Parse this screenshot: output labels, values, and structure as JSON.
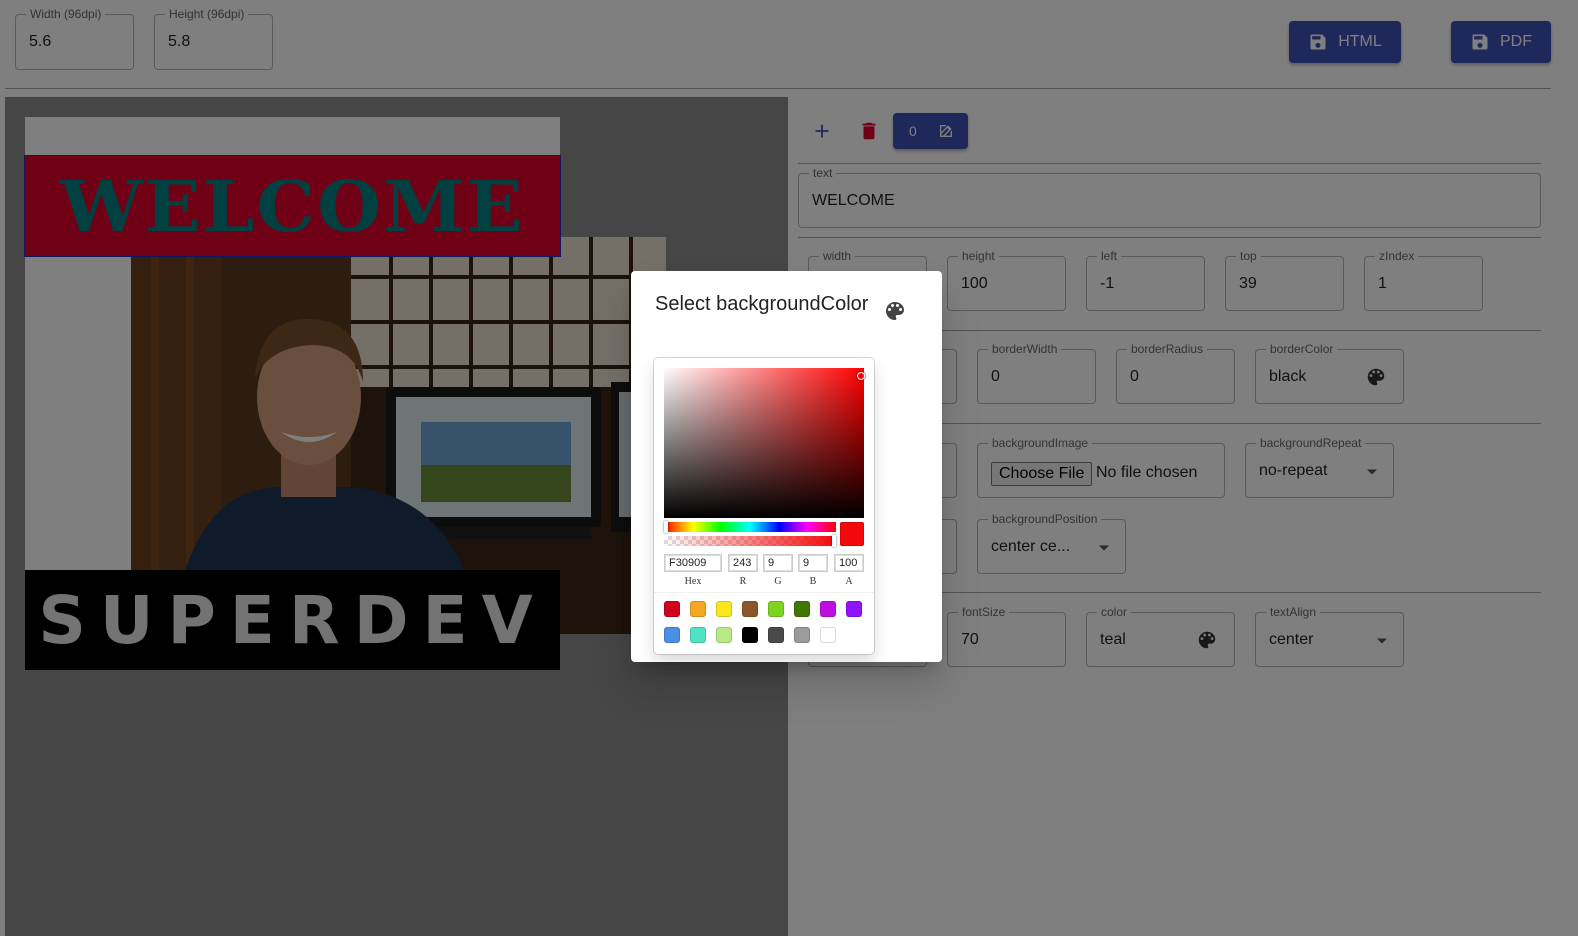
{
  "top_bar": {
    "width_label": "Width (96dpi)",
    "width_value": "5.6",
    "height_label": "Height (96dpi)",
    "height_value": "5.8",
    "html_button": "HTML",
    "pdf_button": "PDF"
  },
  "canvas": {
    "welcome_text": "WELCOME",
    "superdev_text": "SUPERDEV",
    "welcome_bg": "#e0002a",
    "welcome_color": "teal"
  },
  "toolbar": {
    "layer_index": "0"
  },
  "props": {
    "text_label": "text",
    "text_value": "WELCOME",
    "width_label": "width",
    "height_label": "height",
    "height_value": "100",
    "left_label": "left",
    "left_value": "-1",
    "top_label": "top",
    "top_value": "39",
    "zindex_label": "zIndex",
    "zindex_value": "1",
    "borderwidth_label": "borderWidth",
    "borderwidth_value": "0",
    "borderradius_label": "borderRadius",
    "borderradius_value": "0",
    "bordercolor_label": "borderColor",
    "bordercolor_value": "black",
    "bgimage_label": "backgroundImage",
    "choose_file": "Choose File",
    "no_file": "No file chosen",
    "bgrepeat_label": "backgroundRepeat",
    "bgrepeat_value": "no-repeat",
    "bgposition_label": "backgroundPosition",
    "bgposition_value": "center ce...",
    "fontsize_label": "fontSize",
    "fontsize_value": "70",
    "color_label": "color",
    "color_value": "teal",
    "textalign_label": "textAlign",
    "textalign_value": "center"
  },
  "dialog": {
    "title": "Select backgroundColor",
    "picker": {
      "hex": "F30909",
      "r": "243",
      "g": "9",
      "b": "9",
      "a": "100",
      "hex_label": "Hex",
      "r_label": "R",
      "g_label": "G",
      "b_label": "B",
      "a_label": "A",
      "current_color": "#F30909",
      "hue_color": "#ff0000",
      "presets": [
        "#D0021B",
        "#F5A623",
        "#F8E71C",
        "#8B572A",
        "#7ED321",
        "#417505",
        "#BD10E0",
        "#9013FE",
        "#4A90E2",
        "#50E3C2",
        "#B8E986",
        "#000000",
        "#4A4A4A",
        "#9B9B9B",
        "#FFFFFF"
      ]
    }
  },
  "icons": {
    "save": "save-icon",
    "add": "add-icon",
    "delete": "delete-icon",
    "edit": "edit-icon",
    "palette": "palette-icon"
  },
  "colors": {
    "primary": "#3f51b5",
    "delete": "#e0002a"
  }
}
